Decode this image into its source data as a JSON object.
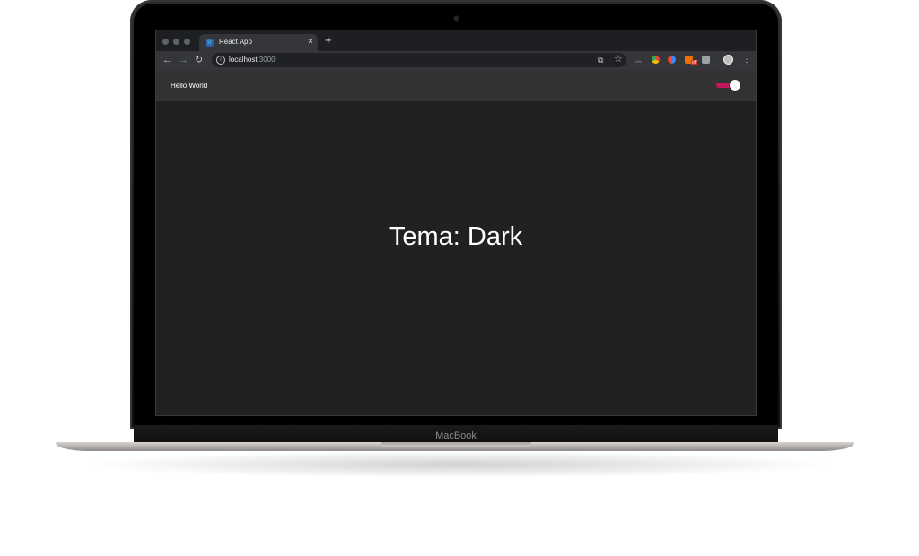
{
  "device": {
    "brand_label": "MacBook"
  },
  "browser": {
    "tab": {
      "title": "React App",
      "close_glyph": "×",
      "icon": "react-logo-icon"
    },
    "new_tab_glyph": "+",
    "address_bar": {
      "host": "localhost",
      "port": ":3000"
    }
  },
  "app": {
    "title": "Hello World",
    "theme_toggle": {
      "checked": true,
      "accent_color": "#c2185b"
    },
    "theme_text": "Tema: Dark"
  }
}
